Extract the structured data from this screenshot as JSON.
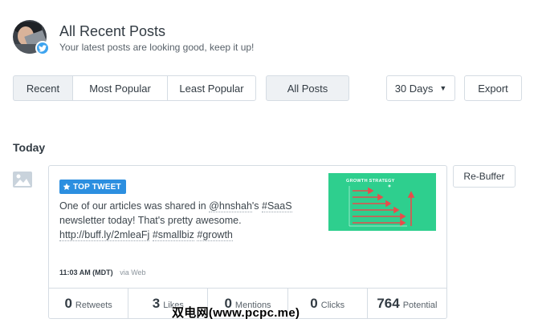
{
  "header": {
    "title": "All Recent Posts",
    "subtitle": "Your latest posts are looking good, keep it up!",
    "network_icon": "twitter-icon"
  },
  "filters": {
    "sort_tabs": [
      {
        "label": "Recent",
        "selected": true
      },
      {
        "label": "Most Popular",
        "selected": false
      },
      {
        "label": "Least Popular",
        "selected": false
      }
    ],
    "post_type": "All Posts",
    "range": "30 Days",
    "export_label": "Export"
  },
  "section": {
    "label": "Today"
  },
  "post": {
    "badge": "TOP TWEET",
    "text_prefix": "One of our articles was shared in ",
    "mention": "@hnshah",
    "text_mid": "'s ",
    "hashtag1": "#SaaS",
    "text_suffix": " newsletter today! That's pretty awesome. ",
    "link": "http://buff.ly/2mleaFj",
    "hashtag2": "#smallbiz",
    "hashtag3": "#growth",
    "time": "11:03 AM (MDT)",
    "via": "via Web",
    "thumbnail_title": "GROWTH STRATEGY",
    "rebuffer_label": "Re-Buffer",
    "stats": [
      {
        "value": "0",
        "label": "Retweets"
      },
      {
        "value": "3",
        "label": "Likes"
      },
      {
        "value": "0",
        "label": "Mentions"
      },
      {
        "value": "0",
        "label": "Clicks"
      },
      {
        "value": "764",
        "label": "Potential"
      }
    ]
  },
  "watermark": "双电网(www.pcpc.me)",
  "colors": {
    "accent": "#2c8fe0",
    "twitter": "#3ea4ef",
    "thumbnail": "#2ecf8e",
    "border": "#d5dce3"
  }
}
